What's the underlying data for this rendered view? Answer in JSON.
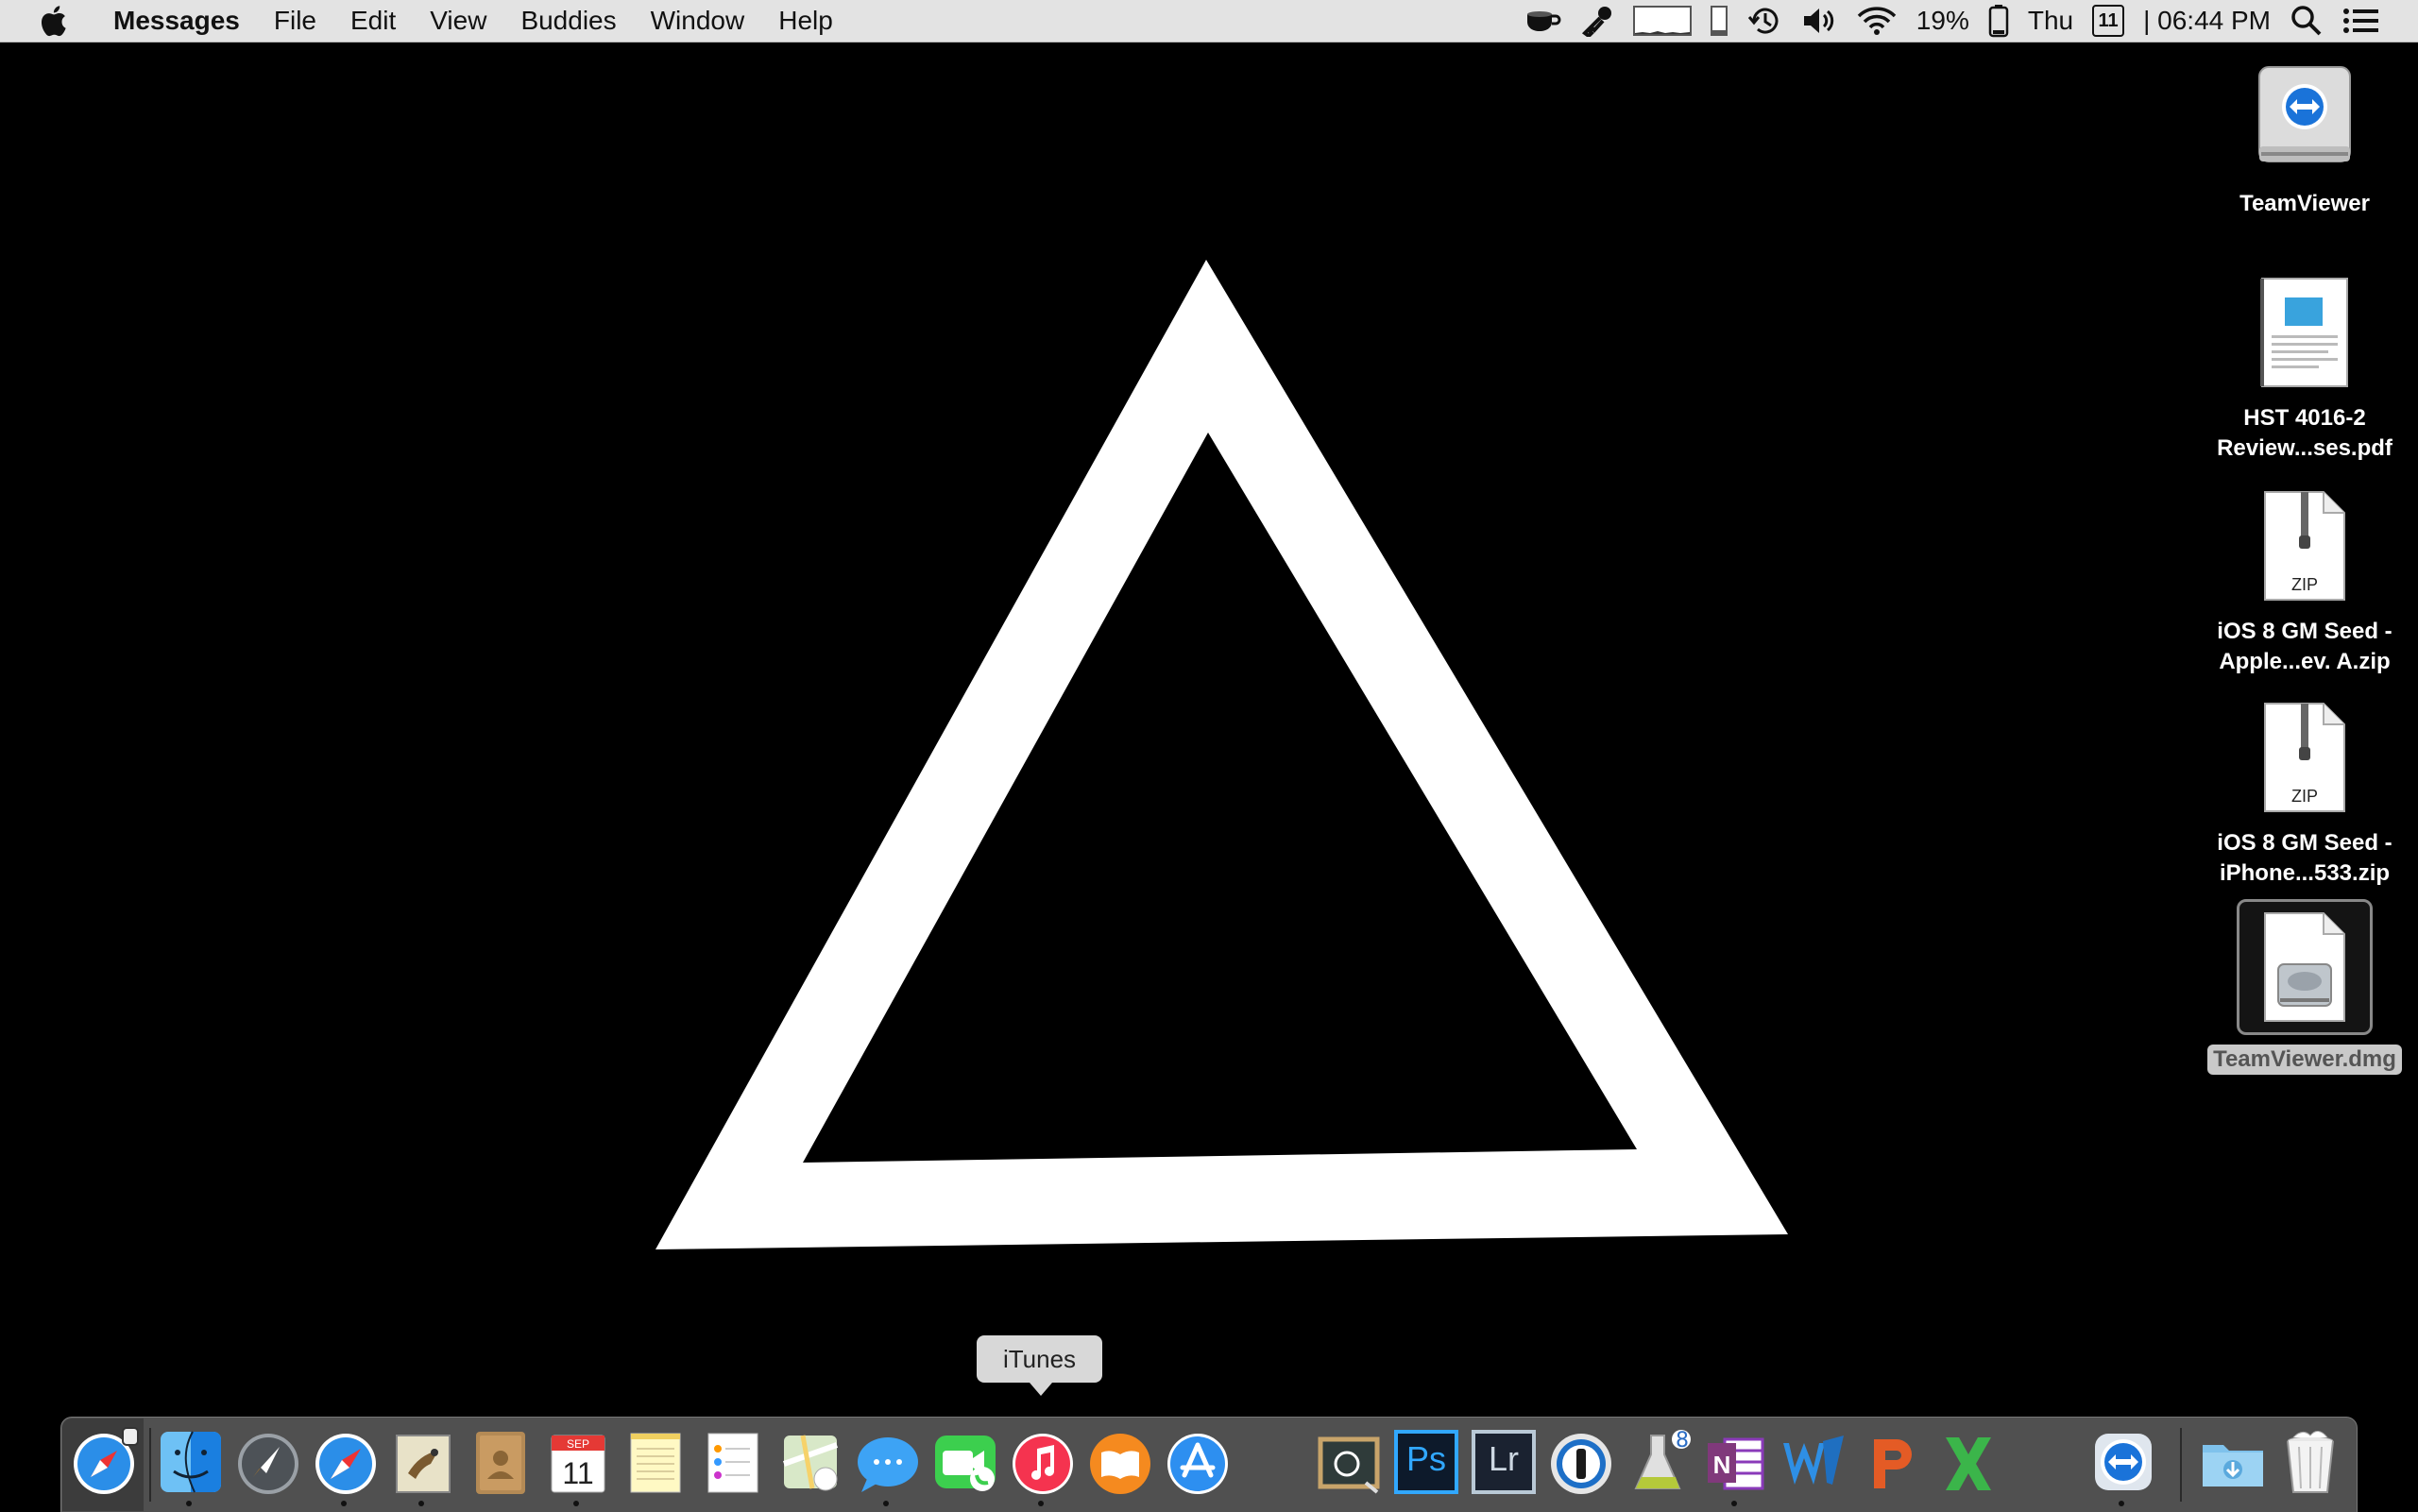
{
  "menubar": {
    "app_name": "Messages",
    "menus": [
      "File",
      "Edit",
      "View",
      "Buddies",
      "Window",
      "Help"
    ],
    "battery": "19%",
    "day": "Thu",
    "date_badge": "11",
    "time": "| 06:44 PM"
  },
  "desktop_icons": [
    {
      "label": "TeamViewer",
      "icon": "drive-icon"
    },
    {
      "label": "HST 4016-2\nReview...ses.pdf",
      "icon": "pdf-icon"
    },
    {
      "label": "iOS 8 GM Seed -\nApple...ev. A.zip",
      "icon": "zip-icon",
      "badge": "ZIP"
    },
    {
      "label": "iOS 8 GM Seed -\niPhone...533.zip",
      "icon": "zip-icon",
      "badge": "ZIP"
    },
    {
      "label": "TeamViewer.dmg",
      "icon": "dmg-icon",
      "selected": true
    }
  ],
  "tooltip": "iTunes",
  "dock": {
    "calendar_month": "SEP",
    "calendar_day": "11",
    "ps_label": "Ps",
    "lr_label": "Lr",
    "onenote_label": "N"
  },
  "colors": {
    "menubar_bg": "#e3e3e3",
    "desktop_bg": "#000000",
    "dock_bg": "#505050"
  }
}
